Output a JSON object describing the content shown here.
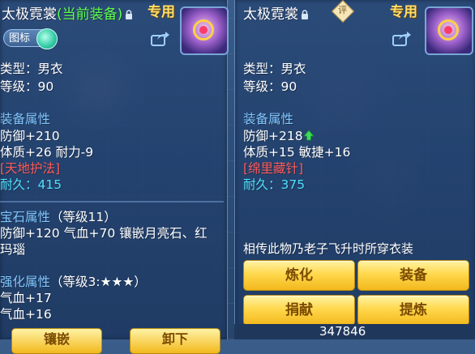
{
  "left": {
    "title_name": "太极霓裳",
    "title_tag": "(当前装备)",
    "exclusive": "专用",
    "icon_button": "图标",
    "type": "类型：男衣",
    "level": "等级：90",
    "equip_attr_header": "装备属性",
    "defense": "防御+210",
    "stats_line": "体质+26 耐力-9",
    "skill": "[天地护法]",
    "durability": "耐久：415",
    "gem_attr_header": "宝石属性",
    "gem_level": "（等级11）",
    "gem_line1": "防御+120 气血+70 镶嵌月亮石、红",
    "gem_line2": "玛瑙",
    "enhance_header": "强化属性",
    "enhance_level": "（等级3:★★★）",
    "enhance_line1": "气血+17",
    "enhance_line2": "气血+16",
    "button_inlay": "镶嵌",
    "button_remove": "卸下"
  },
  "right": {
    "title_name": "太极霓裳",
    "badge": "评",
    "exclusive": "专用",
    "type": "类型：男衣",
    "level": "等级：90",
    "equip_attr_header": "装备属性",
    "defense": "防御+218",
    "stats_line": "体质+15 敏捷+16",
    "skill": "[绵里藏针]",
    "durability": "耐久：375",
    "description": "相传此物乃老子飞升时所穿衣装",
    "buttons": {
      "refine": "炼化",
      "equip": "装备",
      "donate": "捐献",
      "extract": "提炼"
    }
  },
  "bottom_value": "347846",
  "colors": {
    "accent_gold": "#ffd84d",
    "header_blue": "#7fc6ff",
    "skill_red": "#ff5a5a",
    "durability_cyan": "#4fe0ff",
    "highlight_green": "#5dff4a"
  }
}
